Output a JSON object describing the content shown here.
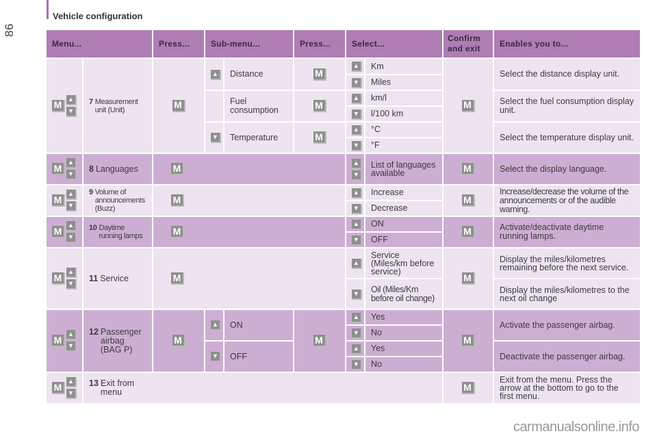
{
  "page": {
    "number": "86",
    "section_title": "Vehicle configuration",
    "watermark": "carmanualsonline.info",
    "accent_color": "#b07cb4",
    "row_light_color": "#ede4f0",
    "row_dark_color": "#cdaed3"
  },
  "icons": {
    "menu_key": "M",
    "up_arrow": "▲",
    "down_arrow": "▼"
  },
  "table": {
    "headers": {
      "menu": "Menu...",
      "press1": "Press...",
      "submenu": "Sub-menu...",
      "press2": "Press...",
      "select": "Select...",
      "confirm": "Confirm and exit",
      "enables": "Enables you to..."
    },
    "rows": [
      {
        "number": "7",
        "label": "Measurement unit (Unit)",
        "submenus": [
          {
            "arrow": "up",
            "label": "Distance",
            "options": [
              {
                "arrow": "up",
                "label": "Km"
              },
              {
                "arrow": "down",
                "label": "Miles"
              }
            ],
            "enables": "Select the distance display unit."
          },
          {
            "arrow": "",
            "label": "Fuel consumption",
            "options": [
              {
                "arrow": "up",
                "label": "km/l"
              },
              {
                "arrow": "down",
                "label": "l/100 km"
              }
            ],
            "enables": "Select the fuel consumption display unit."
          },
          {
            "arrow": "down",
            "label": "Temperature",
            "options": [
              {
                "arrow": "up",
                "label": "°C"
              },
              {
                "arrow": "down",
                "label": "°F"
              }
            ],
            "enables": "Select the temperature display unit."
          }
        ]
      },
      {
        "number": "8",
        "label": "Languages",
        "options": [
          {
            "arrow": "up-down",
            "label": "List of languages available"
          }
        ],
        "enables": "Select the display language."
      },
      {
        "number": "9",
        "label": "Volume of announcements (Buzz)",
        "options": [
          {
            "arrow": "up",
            "label": "Increase"
          },
          {
            "arrow": "down",
            "label": "Decrease"
          }
        ],
        "enables": "Increase/decrease the volume of the announcements or of the audible warning."
      },
      {
        "number": "10",
        "label": "Daytime running lamps",
        "options": [
          {
            "arrow": "up",
            "label": "ON"
          },
          {
            "arrow": "down",
            "label": "OFF"
          }
        ],
        "enables": "Activate/deactivate daytime running lamps."
      },
      {
        "number": "11",
        "label": "Service",
        "options": [
          {
            "arrow": "up",
            "label": "Service (Miles/km before service)",
            "enables": "Display the miles/kilometres remaining before the next service."
          },
          {
            "arrow": "down",
            "label": "Oil (Miles/Km before oil change)",
            "enables": "Display the miles/kilometres to the next oil change"
          }
        ]
      },
      {
        "number": "12",
        "label": "Passenger airbag (BAG P)",
        "submenus": [
          {
            "arrow": "up",
            "label": "ON",
            "options": [
              {
                "arrow": "up",
                "label": "Yes"
              },
              {
                "arrow": "down",
                "label": "No"
              }
            ],
            "enables": "Activate the passenger airbag."
          },
          {
            "arrow": "down",
            "label": "OFF",
            "options": [
              {
                "arrow": "up",
                "label": "Yes"
              },
              {
                "arrow": "down",
                "label": "No"
              }
            ],
            "enables": "Deactivate the passenger airbag."
          }
        ]
      },
      {
        "number": "13",
        "label": "Exit from menu",
        "enables": "Exit from the menu. Press the arrow at the bottom to go to the first menu."
      }
    ]
  }
}
